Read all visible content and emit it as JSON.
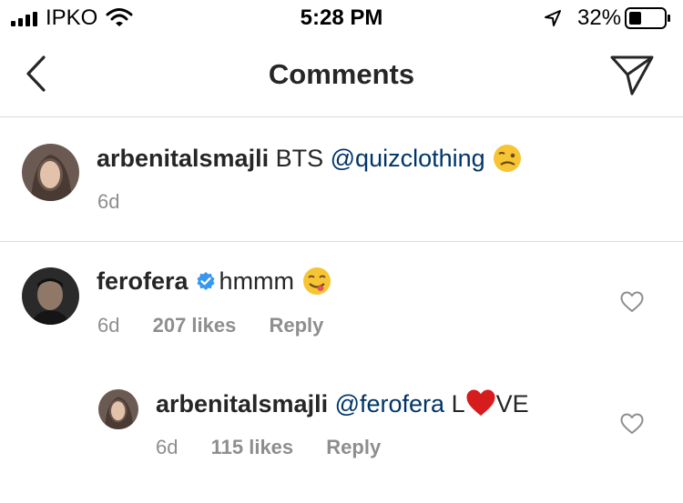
{
  "status_bar": {
    "carrier": "IPKO",
    "time": "5:28 PM",
    "battery": "32%"
  },
  "header": {
    "title": "Comments"
  },
  "caption": {
    "username": "arbenitalsmajli",
    "text": "BTS",
    "mention": "@quizclothing",
    "time": "6d"
  },
  "comments": [
    {
      "username": "ferofera",
      "verified": true,
      "text": "hmmm",
      "time": "6d",
      "likes": "207 likes",
      "reply_label": "Reply"
    }
  ],
  "replies": [
    {
      "username": "arbenitalsmajli",
      "mention": "@ferofera",
      "text_before": "L",
      "text_after": "VE",
      "time": "6d",
      "likes": "115 likes",
      "reply_label": "Reply"
    }
  ],
  "colors": {
    "mention": "#003569",
    "verified": "#3897f0",
    "heart": "#d61d1d"
  }
}
